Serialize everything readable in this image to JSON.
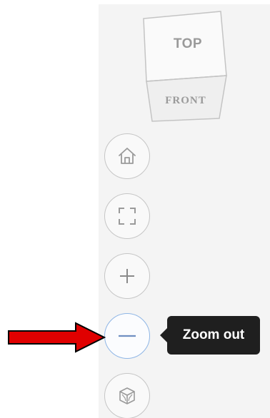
{
  "viewcube": {
    "top_label": "TOP",
    "front_label": "FRONT"
  },
  "controls": [
    {
      "id": "home",
      "icon": "home-icon"
    },
    {
      "id": "fit",
      "icon": "fit-to-view-icon"
    },
    {
      "id": "zoom_in",
      "icon": "plus-icon"
    },
    {
      "id": "zoom_out",
      "icon": "minus-icon",
      "state": "hover"
    },
    {
      "id": "view_3d",
      "icon": "3d-cube-icon"
    }
  ],
  "tooltip": {
    "text": "Zoom out"
  },
  "annotation": {
    "arrow_icon": "red-arrow-right-icon",
    "color": "#e00000"
  },
  "colors": {
    "panel_bg": "#f4f4f4",
    "button_border": "#c6c6c6",
    "active_border": "#8fb6e6",
    "icon_stroke": "#9a9a9a",
    "tooltip_bg": "#1f1f1f"
  }
}
